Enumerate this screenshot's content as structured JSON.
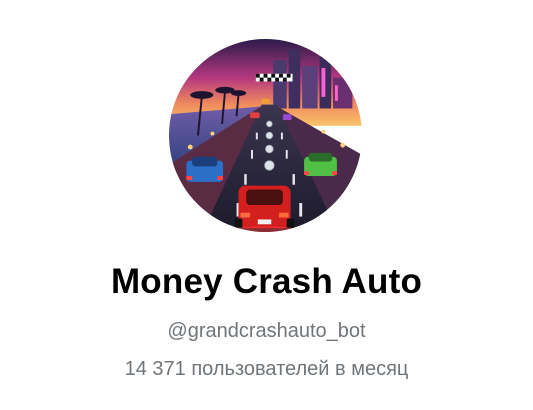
{
  "profile": {
    "title": "Money Crash Auto",
    "username": "@grandcrashauto_bot",
    "monthly_users": "14 371 пользователей в месяц",
    "avatar_icon": "racing-game-avatar-icon"
  },
  "colors": {
    "title": "#000000",
    "secondary_text": "#707579",
    "background": "#ffffff"
  }
}
